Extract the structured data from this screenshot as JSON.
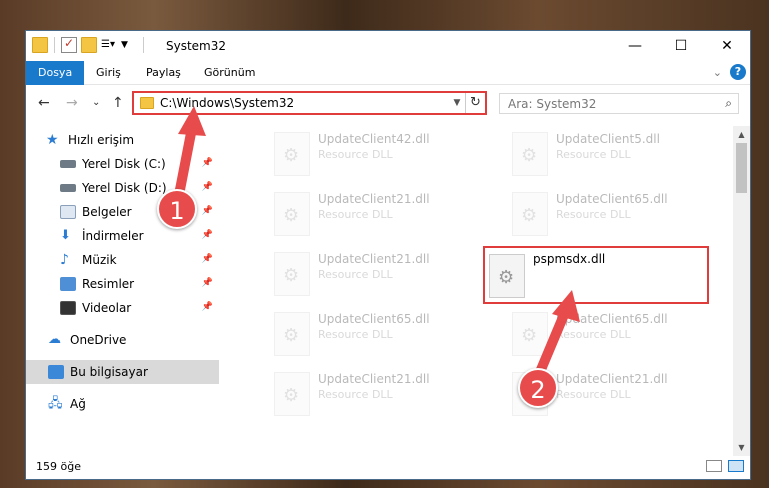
{
  "window": {
    "title": "System32",
    "minimize": "—",
    "maximize": "☐",
    "close": "✕"
  },
  "ribbon": {
    "tabs": [
      "Dosya",
      "Giriş",
      "Paylaş",
      "Görünüm"
    ],
    "active_tab": "Dosya",
    "expand": "⌄",
    "help": "?"
  },
  "address": {
    "path": "C:\\Windows\\System32",
    "search_placeholder": "Ara: System32"
  },
  "nav": {
    "back": "←",
    "forward": "→",
    "recent": "⌄",
    "up": "↑",
    "items": [
      {
        "label": "Hızlı erişim",
        "icon": "star-icon"
      },
      {
        "label": "Yerel Disk (C:)",
        "icon": "disk-icon",
        "pinned": true
      },
      {
        "label": "Yerel Disk (D:)",
        "icon": "disk-icon",
        "pinned": true
      },
      {
        "label": "Belgeler",
        "icon": "documents-icon",
        "pinned": true
      },
      {
        "label": "İndirmeler",
        "icon": "download-icon",
        "pinned": true
      },
      {
        "label": "Müzik",
        "icon": "music-icon",
        "pinned": true
      },
      {
        "label": "Resimler",
        "icon": "pictures-icon",
        "pinned": true
      },
      {
        "label": "Videolar",
        "icon": "videos-icon",
        "pinned": true
      },
      {
        "label": "OneDrive",
        "icon": "cloud-icon"
      },
      {
        "label": "Bu bilgisayar",
        "icon": "computer-icon",
        "selected": true
      },
      {
        "label": "Ağ",
        "icon": "network-icon"
      }
    ]
  },
  "files": [
    {
      "name": "UpdateClient42.dll",
      "type": "Resource DLL"
    },
    {
      "name": "UpdateClient5.dll",
      "type": "Resource DLL"
    },
    {
      "name": "UpdateClient21.dll",
      "type": "Resource DLL"
    },
    {
      "name": "UpdateClient65.dll",
      "type": "Resource DLL"
    },
    {
      "name": "UpdateClient21.dll",
      "type": "Resource DLL"
    },
    {
      "name": "pspmsdx.dll",
      "type": "",
      "highlighted": true
    },
    {
      "name": "UpdateClient65.dll",
      "type": "Resource DLL"
    },
    {
      "name": "UpdateClient65.dll",
      "type": "Resource DLL"
    },
    {
      "name": "UpdateClient21.dll",
      "type": "Resource DLL"
    },
    {
      "name": "UpdateClient21.dll",
      "type": "Resource DLL"
    }
  ],
  "status": {
    "count": "159 öğe"
  },
  "annotations": {
    "marker1": "1",
    "marker2": "2",
    "color": "#e84b4b"
  }
}
